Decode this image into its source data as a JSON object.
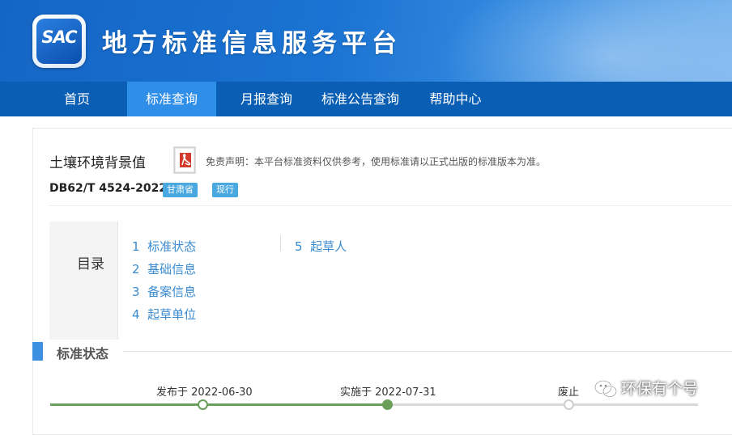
{
  "header": {
    "logo_text": "SAC",
    "site_title": "地方标准信息服务平台"
  },
  "nav": {
    "items": [
      {
        "label": "首页",
        "active": false
      },
      {
        "label": "标准查询",
        "active": true
      },
      {
        "label": "月报查询",
        "active": false
      },
      {
        "label": "标准公告查询",
        "active": false
      },
      {
        "label": "帮助中心",
        "active": false
      }
    ]
  },
  "standard": {
    "name": "土壤环境背景值",
    "disclaimer": "免责声明：本平台标准资料仅供参考，使用标准请以正式出版的标准版本为准。",
    "code": "DB62/T 4524-2022",
    "province_badge": "甘肃省",
    "status_badge": "现行"
  },
  "toc": {
    "title": "目录",
    "items": [
      {
        "num": "1",
        "label": "标准状态"
      },
      {
        "num": "2",
        "label": "基础信息"
      },
      {
        "num": "3",
        "label": "备案信息"
      },
      {
        "num": "4",
        "label": "起草单位"
      },
      {
        "num": "5",
        "label": "起草人"
      }
    ]
  },
  "status_section": {
    "title": "标准状态",
    "timeline": [
      {
        "label": "发布于 2022-06-30",
        "state": "done"
      },
      {
        "label": "实施于 2022-07-31",
        "state": "current"
      },
      {
        "label": "废止",
        "state": "pending"
      }
    ]
  },
  "watermark": {
    "text": "环保有个号",
    "icon": "wechat-icon"
  },
  "colors": {
    "banner": "#1a73d2",
    "nav": "#0a5fb4",
    "nav_active": "#2e8ee8",
    "link": "#3a8bd0",
    "badge": "#4aa8e0",
    "timeline": "#6a9e5b"
  }
}
